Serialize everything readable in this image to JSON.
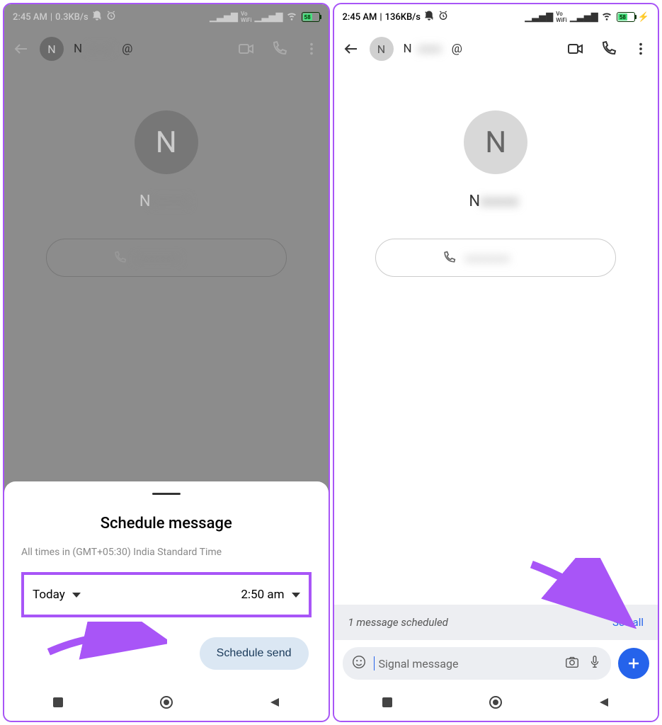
{
  "left": {
    "status": {
      "time": "2:45 AM",
      "speed": "0.3KB/s",
      "battery": "58"
    },
    "header": {
      "avatar_letter": "N",
      "name_prefix": "N",
      "at": "@"
    },
    "profile": {
      "avatar_letter": "N",
      "name_prefix": "N"
    },
    "sheet": {
      "title": "Schedule message",
      "subtitle": "All times in (GMT+05:30) India Standard Time",
      "day": "Today",
      "time": "2:50 am",
      "button": "Schedule send"
    }
  },
  "right": {
    "status": {
      "time": "2:45 AM",
      "speed": "136KB/s",
      "battery": "58"
    },
    "header": {
      "avatar_letter": "N",
      "name_prefix": "N",
      "at": "@"
    },
    "profile": {
      "avatar_letter": "N",
      "name_prefix": "N"
    },
    "banner": {
      "text": "1 message scheduled",
      "link": "See all"
    },
    "input": {
      "placeholder": "Signal message"
    }
  }
}
